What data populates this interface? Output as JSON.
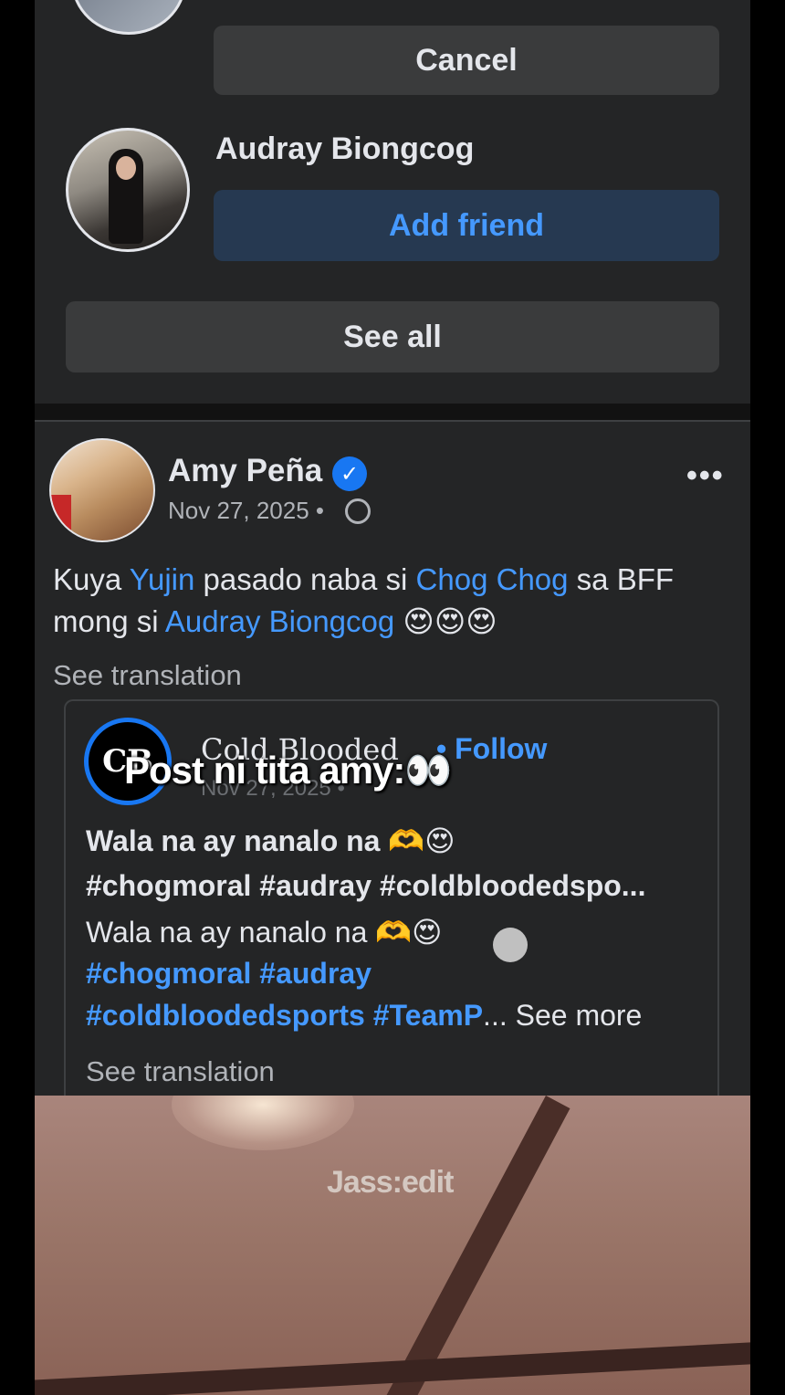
{
  "suggestions": {
    "cancel_label": "Cancel",
    "person_name": "Audray Biongcog",
    "add_friend_label": "Add friend",
    "see_all_label": "See all"
  },
  "post": {
    "author": "Amy Peña",
    "date": "Nov 27, 2025 •",
    "text_parts": {
      "p1": "Kuya ",
      "m1": "Yujin",
      "p2": " pasado naba si ",
      "m2": "Chog Chog",
      "p3": " sa BFF mong si ",
      "m3": "Audray Biongcog",
      "p4": " 😍😍😍"
    },
    "see_translation": "See translation",
    "shared": {
      "logo_text": "CB",
      "page_name": "Cold Blooded",
      "follow_label": "• Follow",
      "date": "Nov 27, 2025 •",
      "line1": "Wala na ay nanalo na 🫶😍",
      "line2": "#chogmoral #audray #coldbloodedspo...",
      "line3": "Wala na ay nanalo na 🫶😍",
      "line4": "#chogmoral #audray",
      "line5_tags": "#coldbloodedsports #TeamP",
      "line5_more": "... See more",
      "see_translation": "See translation"
    }
  },
  "overlay": {
    "caption": "Post ni tita amy:👀",
    "watermark": "Jass:edit"
  }
}
